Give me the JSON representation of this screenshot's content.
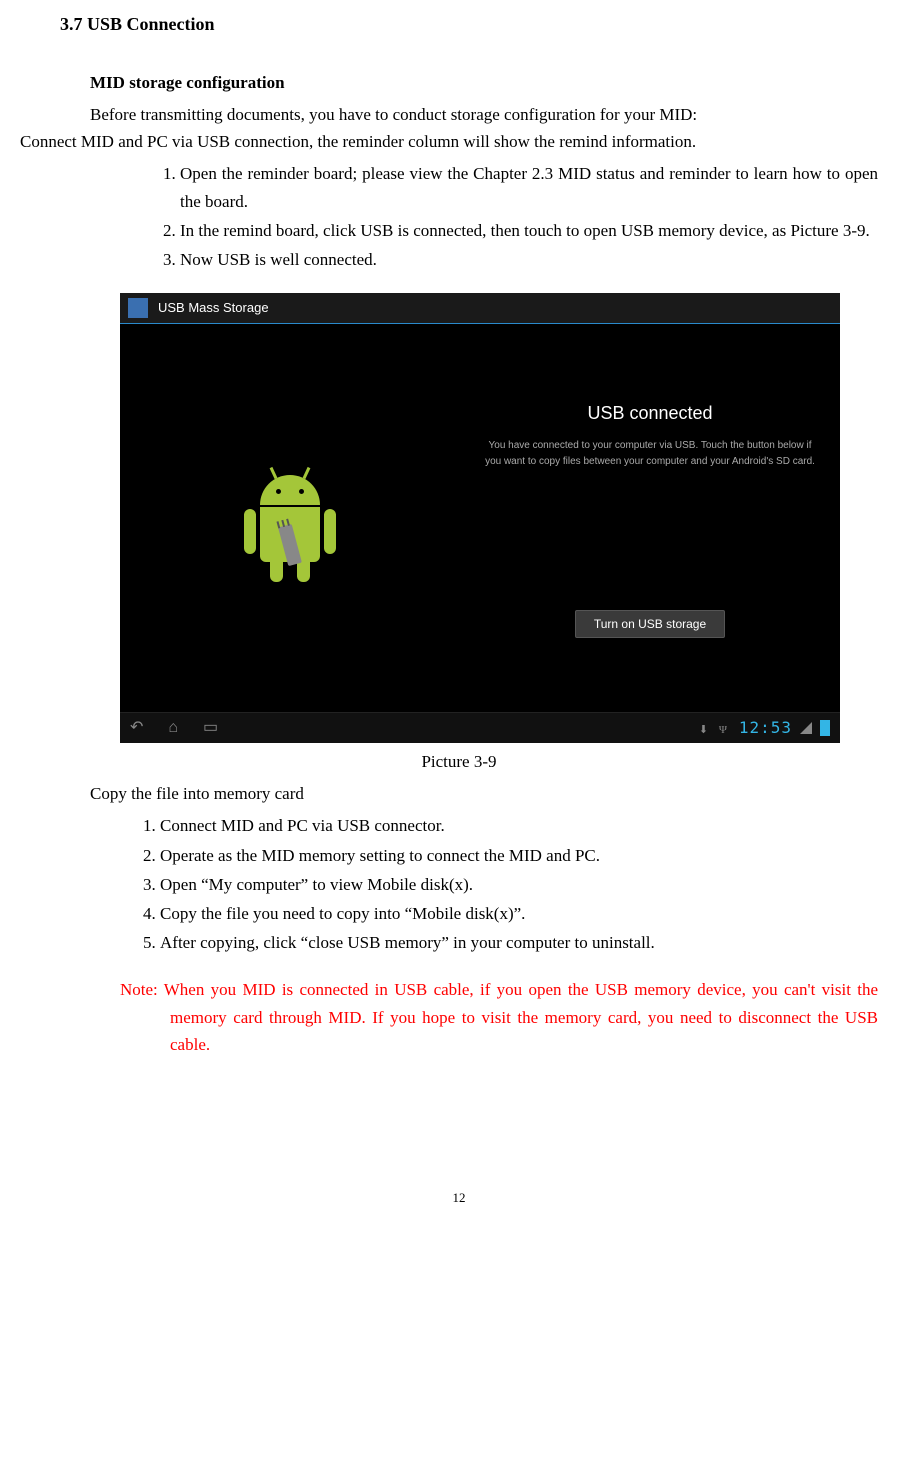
{
  "section_heading": "3.7 USB Connection",
  "subheading": "MID storage configuration",
  "intro_line1": "Before transmitting documents, you have to conduct storage configuration for your MID:",
  "intro_line2": "Connect MID and PC via USB connection, the reminder column will show the remind information.",
  "main_list": [
    "Open the reminder board; please view the Chapter 2.3 MID status and reminder to learn how to open the board.",
    "In the remind board, click USB is connected, then touch to open USB memory device, as Picture 3-9.",
    "Now USB is well connected."
  ],
  "figure": {
    "title_bar": "USB Mass Storage",
    "heading": "USB connected",
    "description": "You have connected to your computer via USB. Touch the button below if you want to copy files between your computer and your Android's SD card.",
    "button": "Turn on USB storage",
    "clock": "12:53"
  },
  "figure_caption": "Picture 3-9",
  "copy_heading": "Copy the file into memory card",
  "copy_list": [
    "Connect MID and PC via USB connector.",
    "Operate as the MID memory setting to connect the MID and PC.",
    "Open “My computer” to view Mobile disk(x).",
    "Copy the file you need to copy into “Mobile disk(x)”.",
    "After copying, click “close USB memory” in your computer to uninstall."
  ],
  "note_text": "Note: When you MID is connected in USB cable, if you open the USB memory device, you can't visit the memory card through MID. If you hope to visit the memory card, you need to disconnect the USB cable.",
  "page_number": "12"
}
